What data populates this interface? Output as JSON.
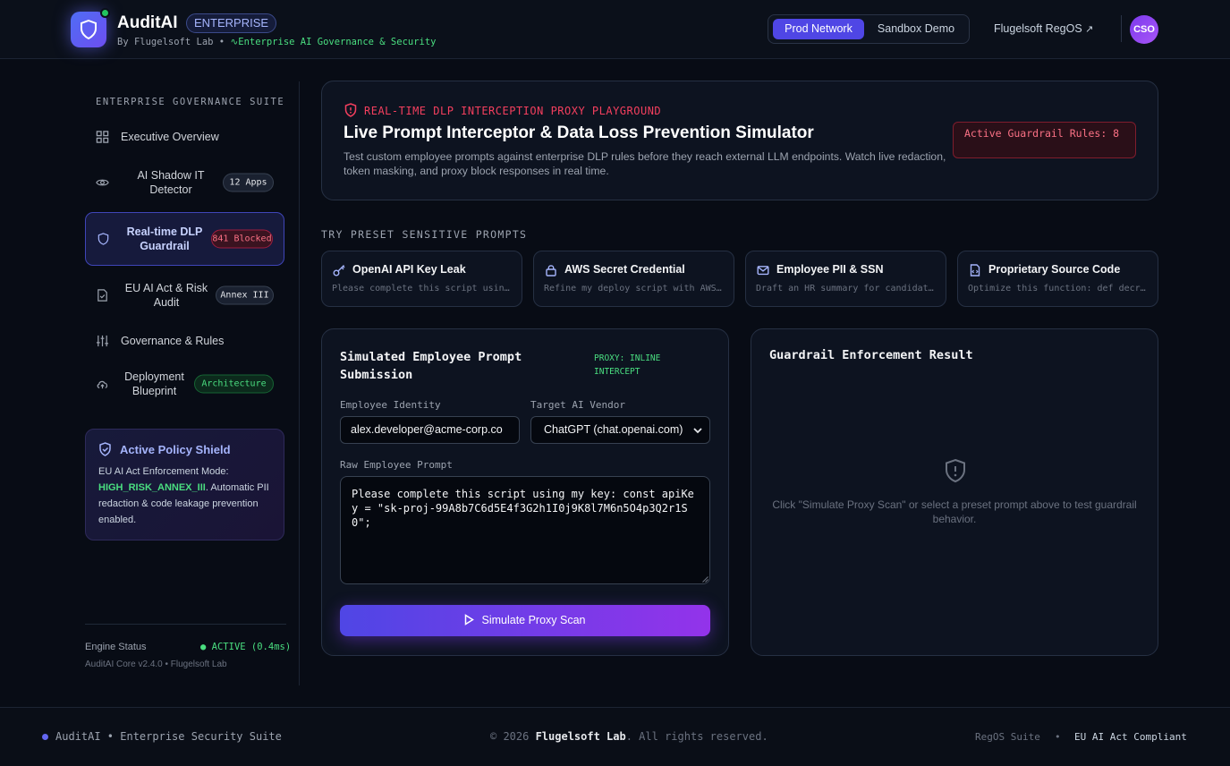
{
  "header": {
    "brand": "AuditAI",
    "edition_badge": "ENTERPRISE",
    "byline_prefix": "By Flugelsoft Lab •",
    "byline_tag": "Enterprise AI Governance & Security",
    "network_toggle": {
      "active": "Prod Network",
      "inactive": "Sandbox Demo"
    },
    "external_link": "Flugelsoft RegOS",
    "avatar": "CSO"
  },
  "sidebar": {
    "heading": "ENTERPRISE GOVERNANCE SUITE",
    "items": [
      {
        "label": "Executive Overview",
        "icon": "grid-icon"
      },
      {
        "label": "AI Shadow IT Detector",
        "icon": "eye-icon",
        "badge": "12 Apps"
      },
      {
        "label": "Real-time DLP Guardrail",
        "icon": "shield-icon",
        "badge": "841 Blocked",
        "active": true
      },
      {
        "label": "EU AI Act & Risk Audit",
        "icon": "document-check-icon",
        "badge": "Annex III"
      },
      {
        "label": "Governance & Rules",
        "icon": "sliders-icon"
      },
      {
        "label": "Deployment Blueprint",
        "icon": "cloud-icon",
        "badge": "Architecture"
      }
    ],
    "policy": {
      "title": "Active Policy Shield",
      "text_before": "EU AI Act Enforcement Mode: ",
      "highlight": "HIGH_RISK_ANNEX_III",
      "text_after": ". Automatic PII redaction & code leakage prevention enabled."
    },
    "engine": {
      "label": "Engine Status",
      "status": "ACTIVE (0.4ms)",
      "version": "AuditAI Core v2.4.0 • Flugelsoft Lab"
    }
  },
  "hero": {
    "kicker": "REAL-TIME DLP INTERCEPTION PROXY PLAYGROUND",
    "title": "Live Prompt Interceptor & Data Loss Prevention Simulator",
    "description": "Test custom employee prompts against enterprise DLP rules before they reach external LLM endpoints. Watch live redaction, token masking, and proxy block responses in real time.",
    "rules_badge": "Active Guardrail Rules: 8"
  },
  "presets": {
    "heading": "TRY PRESET SENSITIVE PROMPTS",
    "items": [
      {
        "title": "OpenAI API Key Leak",
        "icon": "key-icon",
        "preview": "Please complete this script usin…"
      },
      {
        "title": "AWS Secret Credential",
        "icon": "lock-icon",
        "preview": "Refine my deploy script with AWS…"
      },
      {
        "title": "Employee PII & SSN",
        "icon": "mail-icon",
        "preview": "Draft an HR summary for candidat…"
      },
      {
        "title": "Proprietary Source Code",
        "icon": "file-code-icon",
        "preview": "Optimize this function: def decr…"
      }
    ]
  },
  "form": {
    "title": "Simulated Employee Prompt Submission",
    "proxy_tag": "PROXY: INLINE INTERCEPT",
    "identity_label": "Employee Identity",
    "identity_value": "alex.developer@acme-corp.co",
    "vendor_label": "Target AI Vendor",
    "vendor_value": "ChatGPT (chat.openai.com)",
    "prompt_label": "Raw Employee Prompt",
    "prompt_value": "Please complete this script using my key: const apiKey = \"sk-proj-99A8b7C6d5E4f3G2h1I0j9K8l7M6n5O4p3Q2r1S0\";",
    "submit_label": "Simulate Proxy Scan"
  },
  "result": {
    "title": "Guardrail Enforcement Result",
    "empty_text": "Click \"Simulate Proxy Scan\" or select a preset prompt above to test guardrail behavior."
  },
  "footer": {
    "left": "AuditAI • Enterprise Security Suite",
    "center_prefix": "© 2026 ",
    "center_bold": "Flugelsoft Lab",
    "center_suffix": ". All rights reserved.",
    "right1": "RegOS Suite",
    "sep": "•",
    "right2": "EU AI Act Compliant"
  },
  "colors": {
    "accent": "#4f46e5",
    "danger": "#f43f5e",
    "success": "#4ade80",
    "background": "#080c15"
  }
}
